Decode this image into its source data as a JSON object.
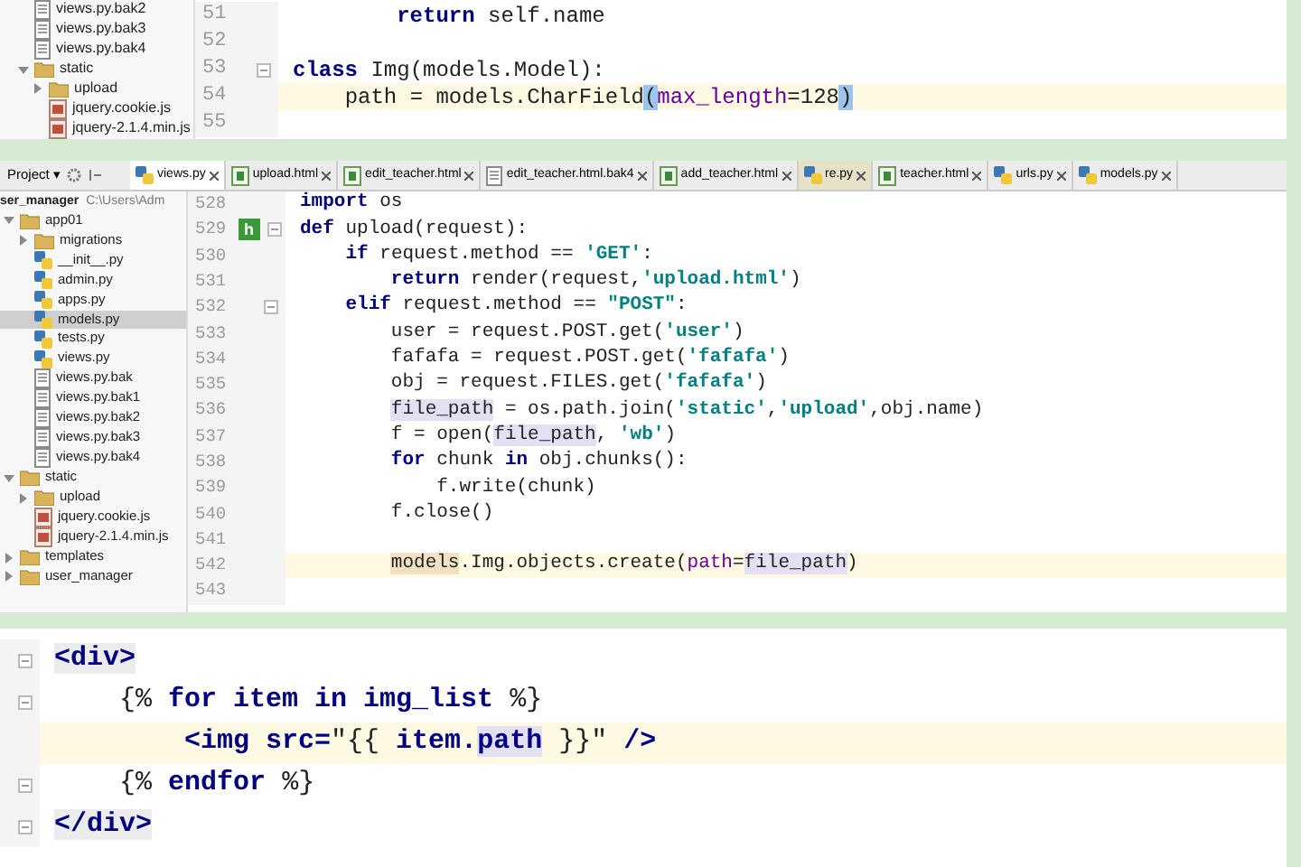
{
  "top_panel": {
    "tree": [
      {
        "name": "views.py.bak2",
        "kind": "text"
      },
      {
        "name": "views.py.bak3",
        "kind": "text"
      },
      {
        "name": "views.py.bak4",
        "kind": "text"
      },
      {
        "name": "static",
        "kind": "folder",
        "expanded": true,
        "children": [
          {
            "name": "upload",
            "kind": "folder",
            "expanded": false
          },
          {
            "name": "jquery.cookie.js",
            "kind": "js"
          },
          {
            "name": "jquery-2.1.4.min.js",
            "kind": "js"
          }
        ]
      }
    ],
    "lines": [
      {
        "number": "51",
        "current": false,
        "fold": false,
        "segments": [
          {
            "kind": "kw",
            "text": "        return"
          },
          {
            "kind": "plain",
            "text": " self.name"
          }
        ]
      },
      {
        "number": "52",
        "current": false,
        "fold": false
      },
      {
        "number": "53",
        "current": false,
        "fold": true,
        "segments": [
          {
            "kind": "kw",
            "text": "class"
          },
          {
            "kind": "plain",
            "text": " Img(models.Model):"
          }
        ]
      },
      {
        "number": "54",
        "current": true,
        "fold": false,
        "segments": [
          {
            "kind": "plain",
            "text": "    path = models.CharField"
          },
          {
            "kind": "brace",
            "text": "("
          },
          {
            "kind": "param",
            "text": "max_length"
          },
          {
            "kind": "plain",
            "text": "=128"
          },
          {
            "kind": "brace",
            "text": ")"
          }
        ]
      },
      {
        "number": "55",
        "current": false,
        "fold": false
      }
    ]
  },
  "main_panel": {
    "toolbar": {
      "label": "Project ▾"
    },
    "tabs": [
      {
        "label": "views.py",
        "kind": "python",
        "selected": true
      },
      {
        "label": "upload.html",
        "kind": "html",
        "selected": false
      },
      {
        "label": "edit_teacher.html",
        "kind": "html",
        "selected": false
      },
      {
        "label": "edit_teacher.html.bak4",
        "kind": "text",
        "selected": false
      },
      {
        "label": "add_teacher.html",
        "kind": "html",
        "selected": false
      },
      {
        "label": "re.py",
        "kind": "python",
        "selected": false
      },
      {
        "label": "teacher.html",
        "kind": "html",
        "selected": false
      },
      {
        "label": "urls.py",
        "kind": "python",
        "selected": false
      },
      {
        "label": "models.py",
        "kind": "python",
        "selected": false
      }
    ],
    "project": {
      "name": "ser_manager",
      "path": "C:\\Users\\Adm"
    },
    "tree": [
      {
        "name": "app01",
        "kind": "folder",
        "expanded": true,
        "selected": false,
        "children": [
          {
            "name": "migrations",
            "kind": "folder",
            "expanded": false,
            "selected": false
          },
          {
            "name": "__init__.py",
            "kind": "python",
            "selected": false
          },
          {
            "name": "admin.py",
            "kind": "python",
            "selected": false
          },
          {
            "name": "apps.py",
            "kind": "python",
            "selected": false
          },
          {
            "name": "models.py",
            "kind": "python",
            "selected": true
          },
          {
            "name": "tests.py",
            "kind": "python",
            "selected": false
          },
          {
            "name": "views.py",
            "kind": "python",
            "selected": false
          },
          {
            "name": "views.py.bak",
            "kind": "text",
            "selected": false
          },
          {
            "name": "views.py.bak1",
            "kind": "text",
            "selected": false
          },
          {
            "name": "views.py.bak2",
            "kind": "text",
            "selected": false
          },
          {
            "name": "views.py.bak3",
            "kind": "text",
            "selected": false
          },
          {
            "name": "views.py.bak4",
            "kind": "text",
            "selected": false
          }
        ]
      },
      {
        "name": "static",
        "kind": "folder",
        "expanded": true,
        "selected": false,
        "children": [
          {
            "name": "upload",
            "kind": "folder",
            "expanded": false,
            "selected": false
          },
          {
            "name": "jquery.cookie.js",
            "kind": "js",
            "selected": false
          },
          {
            "name": "jquery-2.1.4.min.js",
            "kind": "js",
            "selected": false
          }
        ]
      },
      {
        "name": "templates",
        "kind": "folder",
        "expanded": false,
        "selected": false
      },
      {
        "name": "user_manager",
        "kind": "folder",
        "expanded": false,
        "selected": false
      }
    ],
    "lines": [
      {
        "number": "528",
        "current": false,
        "fold": false,
        "segments": [
          {
            "kind": "kw",
            "text": "import"
          },
          {
            "kind": "plain",
            "text": " os"
          }
        ]
      },
      {
        "number": "529",
        "current": false,
        "fold": true,
        "badge": "h",
        "segments": [
          {
            "kind": "kw",
            "text": "def"
          },
          {
            "kind": "plain",
            "text": " upload(request):"
          }
        ]
      },
      {
        "number": "530",
        "current": false,
        "fold": false,
        "segments": [
          {
            "kind": "kw",
            "text": "    if"
          },
          {
            "kind": "plain",
            "text": " request.method == "
          },
          {
            "kind": "str",
            "text": "'GET'"
          },
          {
            "kind": "plain",
            "text": ":"
          }
        ]
      },
      {
        "number": "531",
        "current": false,
        "fold": false,
        "segments": [
          {
            "kind": "kw",
            "text": "        return"
          },
          {
            "kind": "plain",
            "text": " render(request,"
          },
          {
            "kind": "str",
            "text": "'upload.html'"
          },
          {
            "kind": "plain",
            "text": ")"
          }
        ]
      },
      {
        "number": "532",
        "current": false,
        "fold": true,
        "segments": [
          {
            "kind": "kw",
            "text": "    elif"
          },
          {
            "kind": "plain",
            "text": " request.method == "
          },
          {
            "kind": "str",
            "text": "\"POST\""
          },
          {
            "kind": "plain",
            "text": ":"
          }
        ]
      },
      {
        "number": "533",
        "current": false,
        "fold": false,
        "segments": [
          {
            "kind": "plain",
            "text": "        user = request.POST.get("
          },
          {
            "kind": "str",
            "text": "'user'"
          },
          {
            "kind": "plain",
            "text": ")"
          }
        ]
      },
      {
        "number": "534",
        "current": false,
        "fold": false,
        "segments": [
          {
            "kind": "plain",
            "text": "        fafafa = request.POST.get("
          },
          {
            "kind": "str",
            "text": "'fafafa'"
          },
          {
            "kind": "plain",
            "text": ")"
          }
        ]
      },
      {
        "number": "535",
        "current": false,
        "fold": false,
        "segments": [
          {
            "kind": "plain",
            "text": "        obj = request.FILES.get("
          },
          {
            "kind": "str",
            "text": "'fafafa'"
          },
          {
            "kind": "plain",
            "text": ")"
          }
        ]
      },
      {
        "number": "536",
        "current": false,
        "fold": false,
        "segments": [
          {
            "kind": "ref",
            "text": "        file_path"
          },
          {
            "kind": "plain",
            "text": " = os.path.join("
          },
          {
            "kind": "str",
            "text": "'static'"
          },
          {
            "kind": "plain",
            "text": ","
          },
          {
            "kind": "str",
            "text": "'upload'"
          },
          {
            "kind": "plain",
            "text": ",obj.name)"
          }
        ]
      },
      {
        "number": "537",
        "current": false,
        "fold": false,
        "segments": [
          {
            "kind": "plain",
            "text": "        f = open("
          },
          {
            "kind": "ref",
            "text": "file_path"
          },
          {
            "kind": "plain",
            "text": ", "
          },
          {
            "kind": "str",
            "text": "'wb'"
          },
          {
            "kind": "plain",
            "text": ")"
          }
        ]
      },
      {
        "number": "538",
        "current": false,
        "fold": false,
        "segments": [
          {
            "kind": "kw",
            "text": "        for"
          },
          {
            "kind": "plain",
            "text": " chunk "
          },
          {
            "kind": "kw",
            "text": "in"
          },
          {
            "kind": "plain",
            "text": " obj.chunks():"
          }
        ]
      },
      {
        "number": "539",
        "current": false,
        "fold": false,
        "segments": [
          {
            "kind": "plain",
            "text": "            f.write(chunk)"
          }
        ]
      },
      {
        "number": "540",
        "current": false,
        "fold": false,
        "segments": [
          {
            "kind": "plain",
            "text": "        f.close()"
          }
        ]
      },
      {
        "number": "541",
        "current": false,
        "fold": false
      },
      {
        "number": "542",
        "current": true,
        "fold": false,
        "segments": [
          {
            "kind": "usage",
            "text": "        models"
          },
          {
            "kind": "plain",
            "text": ".Img.objects.create("
          },
          {
            "kind": "param",
            "text": "path"
          },
          {
            "kind": "plain",
            "text": "="
          },
          {
            "kind": "ref",
            "text": "file_path"
          },
          {
            "kind": "plain",
            "text": ")"
          }
        ]
      },
      {
        "number": "543",
        "current": false,
        "fold": false
      }
    ]
  },
  "template_panel": {
    "lines": [
      {
        "current": false,
        "fold": true,
        "segments": [
          {
            "kind": "tag",
            "text": "<div>"
          }
        ]
      },
      {
        "current": false,
        "fold": true,
        "segments": [
          {
            "kind": "plain",
            "text": "    {% "
          },
          {
            "kind": "kw",
            "text": "for item in img_list"
          },
          {
            "kind": "plain",
            "text": " %}"
          }
        ]
      },
      {
        "current": true,
        "fold": false,
        "segments": [
          {
            "kind": "kw",
            "text": "        <img src="
          },
          {
            "kind": "plain",
            "text": "\"{{ "
          },
          {
            "kind": "kw",
            "text": "item."
          },
          {
            "kind": "refkw",
            "text": "path"
          },
          {
            "kind": "plain",
            "text": " }}\" "
          },
          {
            "kind": "kw",
            "text": "/>"
          }
        ]
      },
      {
        "current": false,
        "fold": true,
        "segments": [
          {
            "kind": "plain",
            "text": "    {% "
          },
          {
            "kind": "kw",
            "text": "endfor"
          },
          {
            "kind": "plain",
            "text": " %}"
          }
        ]
      },
      {
        "current": false,
        "fold": true,
        "segments": [
          {
            "kind": "tag",
            "text": "</div>"
          }
        ]
      }
    ]
  }
}
